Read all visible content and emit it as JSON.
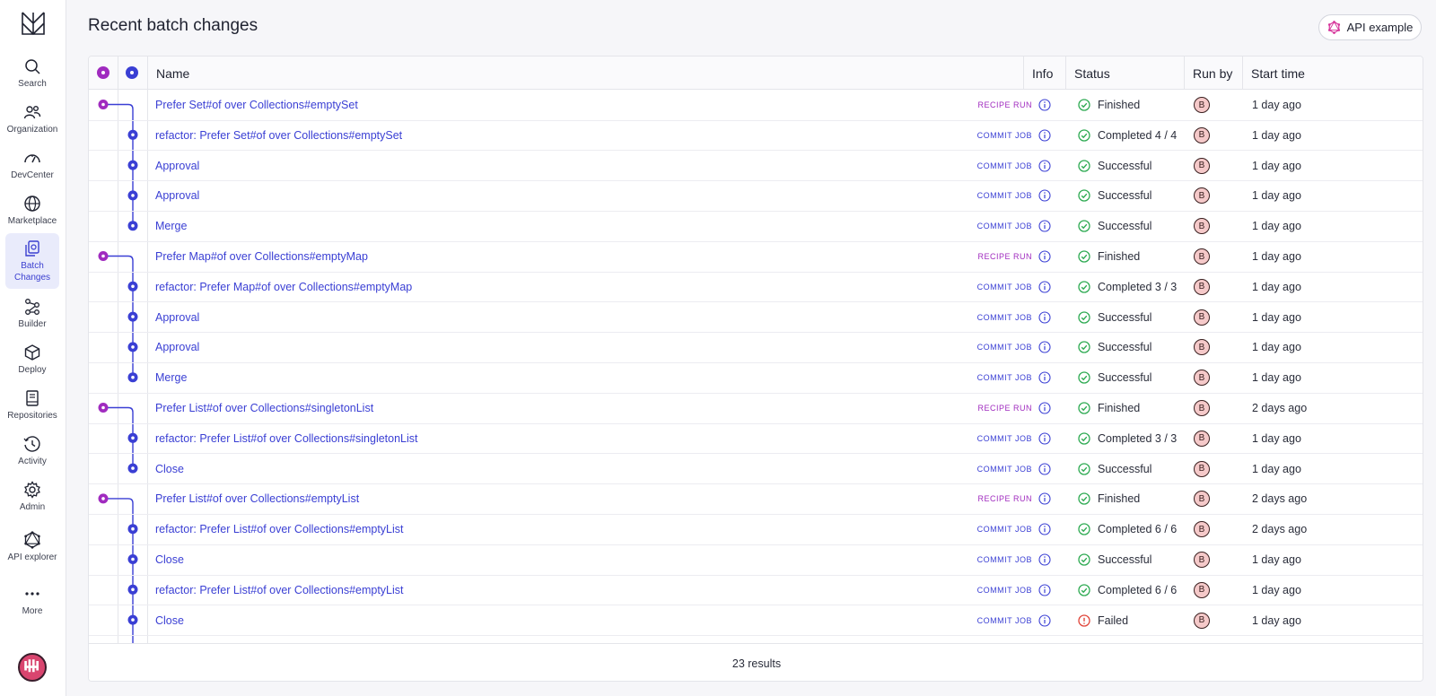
{
  "sidebar": {
    "items": [
      {
        "label": "Search",
        "icon": "search-icon"
      },
      {
        "label": "Organization",
        "icon": "organization-icon"
      },
      {
        "label": "DevCenter",
        "icon": "gauge-icon"
      },
      {
        "label": "Marketplace",
        "icon": "globe-icon"
      },
      {
        "label": "Batch Changes",
        "icon": "batch-changes-icon",
        "active": true
      },
      {
        "label": "Builder",
        "icon": "builder-icon"
      },
      {
        "label": "Deploy",
        "icon": "cube-icon"
      },
      {
        "label": "Repositories",
        "icon": "book-icon"
      },
      {
        "label": "Activity",
        "icon": "clock-icon"
      },
      {
        "label": "Admin",
        "icon": "gear-icon"
      },
      {
        "label": "API explorer",
        "icon": "graphql-icon"
      },
      {
        "label": "More",
        "icon": "more-icon"
      }
    ]
  },
  "page": {
    "title": "Recent batch changes",
    "api_button": "API example"
  },
  "table": {
    "columns": {
      "name": "Name",
      "info": "Info",
      "status": "Status",
      "run_by": "Run by",
      "start_time": "Start time"
    },
    "rows": [
      {
        "name": "Prefer Set#of over Collections#emptySet",
        "type": "RECIPE RUN",
        "kind": "recipe",
        "status": "Finished",
        "state": "ok",
        "run_by": "B",
        "time": "1 day ago"
      },
      {
        "name": "refactor: Prefer Set#of over Collections#emptySet",
        "type": "COMMIT JOB",
        "kind": "commit",
        "status": "Completed 4 / 4",
        "state": "ok",
        "run_by": "B",
        "time": "1 day ago"
      },
      {
        "name": "Approval",
        "type": "COMMIT JOB",
        "kind": "commit",
        "status": "Successful",
        "state": "ok",
        "run_by": "B",
        "time": "1 day ago"
      },
      {
        "name": "Approval",
        "type": "COMMIT JOB",
        "kind": "commit",
        "status": "Successful",
        "state": "ok",
        "run_by": "B",
        "time": "1 day ago"
      },
      {
        "name": "Merge",
        "type": "COMMIT JOB",
        "kind": "commit",
        "status": "Successful",
        "state": "ok",
        "run_by": "B",
        "time": "1 day ago"
      },
      {
        "name": "Prefer Map#of over Collections#emptyMap",
        "type": "RECIPE RUN",
        "kind": "recipe",
        "status": "Finished",
        "state": "ok",
        "run_by": "B",
        "time": "1 day ago"
      },
      {
        "name": "refactor: Prefer Map#of over Collections#emptyMap",
        "type": "COMMIT JOB",
        "kind": "commit",
        "status": "Completed 3 / 3",
        "state": "ok",
        "run_by": "B",
        "time": "1 day ago"
      },
      {
        "name": "Approval",
        "type": "COMMIT JOB",
        "kind": "commit",
        "status": "Successful",
        "state": "ok",
        "run_by": "B",
        "time": "1 day ago"
      },
      {
        "name": "Approval",
        "type": "COMMIT JOB",
        "kind": "commit",
        "status": "Successful",
        "state": "ok",
        "run_by": "B",
        "time": "1 day ago"
      },
      {
        "name": "Merge",
        "type": "COMMIT JOB",
        "kind": "commit",
        "status": "Successful",
        "state": "ok",
        "run_by": "B",
        "time": "1 day ago"
      },
      {
        "name": "Prefer List#of over Collections#singletonList",
        "type": "RECIPE RUN",
        "kind": "recipe",
        "status": "Finished",
        "state": "ok",
        "run_by": "B",
        "time": "2 days ago"
      },
      {
        "name": "refactor: Prefer List#of over Collections#singletonList",
        "type": "COMMIT JOB",
        "kind": "commit",
        "status": "Completed 3 / 3",
        "state": "ok",
        "run_by": "B",
        "time": "1 day ago"
      },
      {
        "name": "Close",
        "type": "COMMIT JOB",
        "kind": "commit",
        "status": "Successful",
        "state": "ok",
        "run_by": "B",
        "time": "1 day ago"
      },
      {
        "name": "Prefer List#of over Collections#emptyList",
        "type": "RECIPE RUN",
        "kind": "recipe",
        "status": "Finished",
        "state": "ok",
        "run_by": "B",
        "time": "2 days ago"
      },
      {
        "name": "refactor: Prefer List#of over Collections#emptyList",
        "type": "COMMIT JOB",
        "kind": "commit",
        "status": "Completed 6 / 6",
        "state": "ok",
        "run_by": "B",
        "time": "2 days ago"
      },
      {
        "name": "Close",
        "type": "COMMIT JOB",
        "kind": "commit",
        "status": "Successful",
        "state": "ok",
        "run_by": "B",
        "time": "1 day ago"
      },
      {
        "name": "refactor: Prefer List#of over Collections#emptyList",
        "type": "COMMIT JOB",
        "kind": "commit",
        "status": "Completed 6 / 6",
        "state": "ok",
        "run_by": "B",
        "time": "1 day ago"
      },
      {
        "name": "Close",
        "type": "COMMIT JOB",
        "kind": "commit",
        "status": "Failed",
        "state": "error",
        "run_by": "B",
        "time": "1 day ago"
      },
      {
        "name": "",
        "type": "",
        "kind": "commit",
        "status": "",
        "state": "ok",
        "run_by": "",
        "time": ""
      }
    ],
    "footer": "23 results"
  },
  "colors": {
    "accent": "#3a3fd4",
    "recipe": "#a02bbf",
    "success": "#2eaa52",
    "error": "#e0453a"
  }
}
